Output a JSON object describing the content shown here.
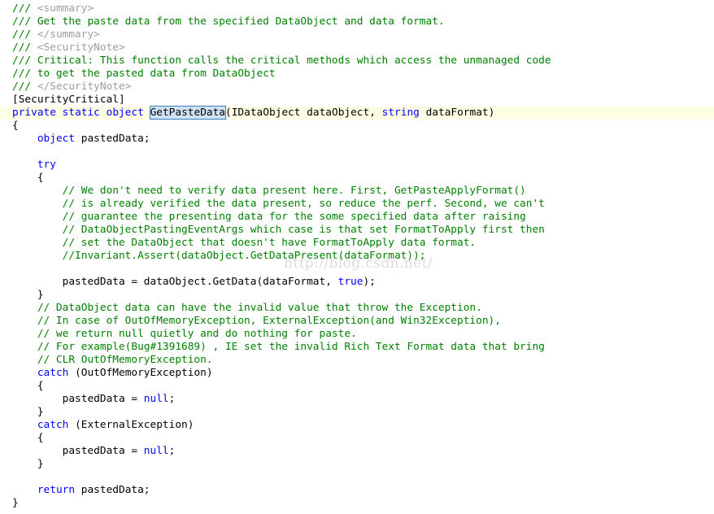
{
  "editor": {
    "language": "C#",
    "background_color": "#ffffff",
    "highlight_line_color": "#fdfde4",
    "selection_color": "#cfe3f7",
    "selection_border_color": "#3a7ebf",
    "keyword_color": "#0000ff",
    "comment_color": "#008000",
    "xml_tag_color": "#9e9e9e",
    "text_color": "#000000",
    "selected_symbol": "GetPasteData",
    "highlighted_line_number": 9
  },
  "watermark": {
    "text": "http://blog.csdn.net/",
    "color": "#dcdcdc"
  },
  "lines": [
    {
      "n": 1,
      "hl": false,
      "tokens": [
        {
          "c": "xmlslash",
          "t": "/// "
        },
        {
          "c": "xmltag",
          "t": "<summary>"
        }
      ]
    },
    {
      "n": 2,
      "hl": false,
      "tokens": [
        {
          "c": "cmt",
          "t": "/// Get the paste data from the specified DataObject and data format."
        }
      ]
    },
    {
      "n": 3,
      "hl": false,
      "tokens": [
        {
          "c": "xmlslash",
          "t": "/// "
        },
        {
          "c": "xmltag",
          "t": "</summary>"
        }
      ]
    },
    {
      "n": 4,
      "hl": false,
      "tokens": [
        {
          "c": "xmlslash",
          "t": "/// "
        },
        {
          "c": "xmltag",
          "t": "<SecurityNote>"
        }
      ]
    },
    {
      "n": 5,
      "hl": false,
      "tokens": [
        {
          "c": "cmt",
          "t": "/// Critical: This function calls the critical methods which access the unmanaged code"
        }
      ]
    },
    {
      "n": 6,
      "hl": false,
      "tokens": [
        {
          "c": "cmt",
          "t": "/// to get the pasted data from DataObject"
        }
      ]
    },
    {
      "n": 7,
      "hl": false,
      "tokens": [
        {
          "c": "xmlslash",
          "t": "/// "
        },
        {
          "c": "xmltag",
          "t": "</SecurityNote>"
        }
      ]
    },
    {
      "n": 8,
      "hl": false,
      "tokens": [
        {
          "c": "plain",
          "t": "[SecurityCritical]"
        }
      ]
    },
    {
      "n": 9,
      "hl": true,
      "tokens": [
        {
          "c": "kw",
          "t": "private"
        },
        {
          "c": "plain",
          "t": " "
        },
        {
          "c": "kw",
          "t": "static"
        },
        {
          "c": "plain",
          "t": " "
        },
        {
          "c": "kw",
          "t": "object"
        },
        {
          "c": "plain",
          "t": " "
        },
        {
          "c": "sel",
          "t": "GetPasteData"
        },
        {
          "c": "plain",
          "t": "(IDataObject dataObject, "
        },
        {
          "c": "kw",
          "t": "string"
        },
        {
          "c": "plain",
          "t": " dataFormat)"
        }
      ]
    },
    {
      "n": 10,
      "hl": false,
      "tokens": [
        {
          "c": "punct",
          "t": "{"
        }
      ]
    },
    {
      "n": 11,
      "hl": false,
      "tokens": [
        {
          "c": "plain",
          "t": "    "
        },
        {
          "c": "kw",
          "t": "object"
        },
        {
          "c": "plain",
          "t": " pastedData;"
        }
      ]
    },
    {
      "n": 12,
      "hl": false,
      "tokens": [
        {
          "c": "plain",
          "t": ""
        }
      ]
    },
    {
      "n": 13,
      "hl": false,
      "tokens": [
        {
          "c": "plain",
          "t": "    "
        },
        {
          "c": "kw",
          "t": "try"
        }
      ]
    },
    {
      "n": 14,
      "hl": false,
      "tokens": [
        {
          "c": "punct",
          "t": "    {"
        }
      ]
    },
    {
      "n": 15,
      "hl": false,
      "tokens": [
        {
          "c": "cmt",
          "t": "        // We don't need to verify data present here. First, GetPasteApplyFormat()"
        }
      ]
    },
    {
      "n": 16,
      "hl": false,
      "tokens": [
        {
          "c": "cmt",
          "t": "        // is already verified the data present, so reduce the perf. Second, we can't"
        }
      ]
    },
    {
      "n": 17,
      "hl": false,
      "tokens": [
        {
          "c": "cmt",
          "t": "        // guarantee the presenting data for the some specified data after raising"
        }
      ]
    },
    {
      "n": 18,
      "hl": false,
      "tokens": [
        {
          "c": "cmt",
          "t": "        // DataObjectPastingEventArgs which case is that set FormatToApply first then"
        }
      ]
    },
    {
      "n": 19,
      "hl": false,
      "tokens": [
        {
          "c": "cmt",
          "t": "        // set the DataObject that doesn't have FormatToApply data format."
        }
      ]
    },
    {
      "n": 20,
      "hl": false,
      "tokens": [
        {
          "c": "cmt",
          "t": "        //Invariant.Assert(dataObject.GetDataPresent(dataFormat));"
        }
      ]
    },
    {
      "n": 21,
      "hl": false,
      "tokens": [
        {
          "c": "plain",
          "t": ""
        }
      ]
    },
    {
      "n": 22,
      "hl": false,
      "tokens": [
        {
          "c": "plain",
          "t": "        pastedData = dataObject.GetData(dataFormat, "
        },
        {
          "c": "kw",
          "t": "true"
        },
        {
          "c": "plain",
          "t": ");"
        }
      ]
    },
    {
      "n": 23,
      "hl": false,
      "tokens": [
        {
          "c": "punct",
          "t": "    }"
        }
      ]
    },
    {
      "n": 24,
      "hl": false,
      "tokens": [
        {
          "c": "cmt",
          "t": "    // DataObject data can have the invalid value that throw the Exception."
        }
      ]
    },
    {
      "n": 25,
      "hl": false,
      "tokens": [
        {
          "c": "cmt",
          "t": "    // In case of OutOfMemoryException, ExternalException(and Win32Exception),"
        }
      ]
    },
    {
      "n": 26,
      "hl": false,
      "tokens": [
        {
          "c": "cmt",
          "t": "    // we return null quietly and do nothing for paste."
        }
      ]
    },
    {
      "n": 27,
      "hl": false,
      "tokens": [
        {
          "c": "cmt",
          "t": "    // For example(Bug#1391689) , IE set the invalid Rich Text Format data that bring"
        }
      ]
    },
    {
      "n": 28,
      "hl": false,
      "tokens": [
        {
          "c": "cmt",
          "t": "    // CLR OutOfMemoryException."
        }
      ]
    },
    {
      "n": 29,
      "hl": false,
      "tokens": [
        {
          "c": "plain",
          "t": "    "
        },
        {
          "c": "kw",
          "t": "catch"
        },
        {
          "c": "plain",
          "t": " (OutOfMemoryException)"
        }
      ]
    },
    {
      "n": 30,
      "hl": false,
      "tokens": [
        {
          "c": "punct",
          "t": "    {"
        }
      ]
    },
    {
      "n": 31,
      "hl": false,
      "tokens": [
        {
          "c": "plain",
          "t": "        pastedData = "
        },
        {
          "c": "kw",
          "t": "null"
        },
        {
          "c": "plain",
          "t": ";"
        }
      ]
    },
    {
      "n": 32,
      "hl": false,
      "tokens": [
        {
          "c": "punct",
          "t": "    }"
        }
      ]
    },
    {
      "n": 33,
      "hl": false,
      "tokens": [
        {
          "c": "plain",
          "t": "    "
        },
        {
          "c": "kw",
          "t": "catch"
        },
        {
          "c": "plain",
          "t": " (ExternalException)"
        }
      ]
    },
    {
      "n": 34,
      "hl": false,
      "tokens": [
        {
          "c": "punct",
          "t": "    {"
        }
      ]
    },
    {
      "n": 35,
      "hl": false,
      "tokens": [
        {
          "c": "plain",
          "t": "        pastedData = "
        },
        {
          "c": "kw",
          "t": "null"
        },
        {
          "c": "plain",
          "t": ";"
        }
      ]
    },
    {
      "n": 36,
      "hl": false,
      "tokens": [
        {
          "c": "punct",
          "t": "    }"
        }
      ]
    },
    {
      "n": 37,
      "hl": false,
      "tokens": [
        {
          "c": "plain",
          "t": ""
        }
      ]
    },
    {
      "n": 38,
      "hl": false,
      "tokens": [
        {
          "c": "plain",
          "t": "    "
        },
        {
          "c": "kw",
          "t": "return"
        },
        {
          "c": "plain",
          "t": " pastedData;"
        }
      ]
    },
    {
      "n": 39,
      "hl": false,
      "tokens": [
        {
          "c": "punct",
          "t": "}"
        }
      ]
    }
  ]
}
